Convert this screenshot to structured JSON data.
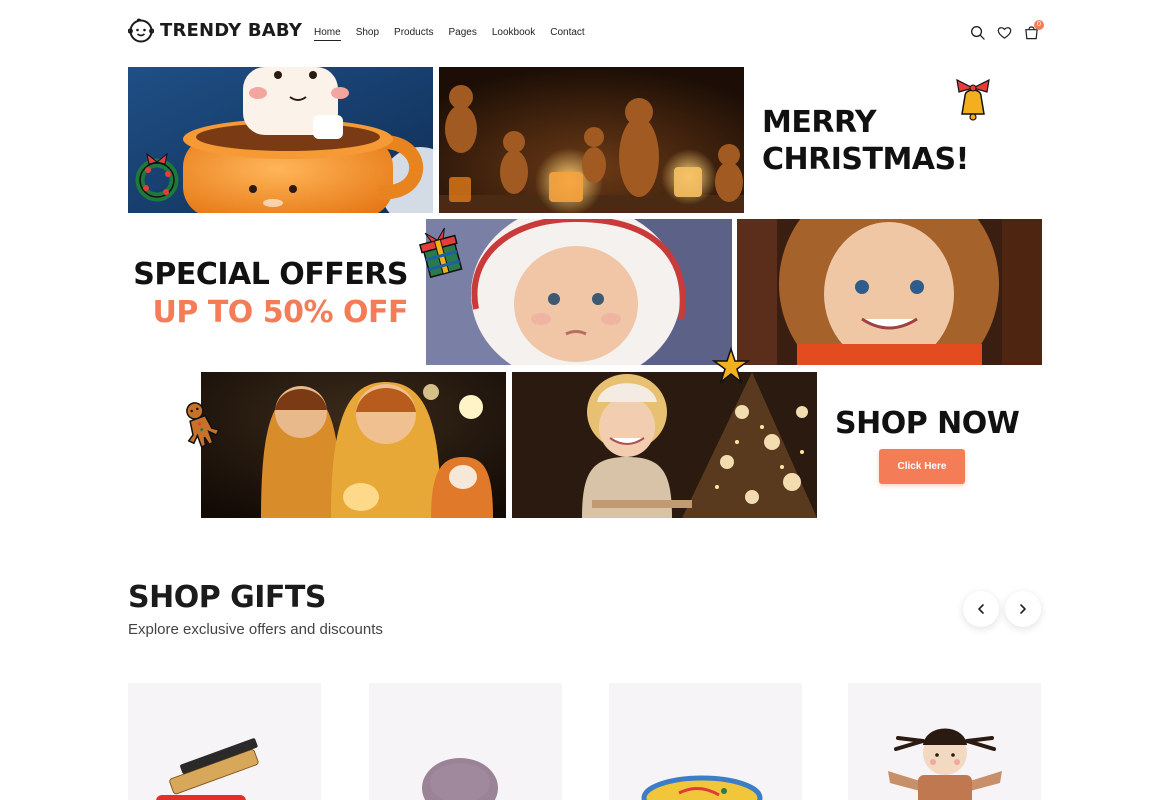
{
  "brand": {
    "name": "TRENDY BABY"
  },
  "nav": {
    "items": [
      {
        "label": "Home",
        "active": true
      },
      {
        "label": "Shop",
        "active": false
      },
      {
        "label": "Products",
        "active": false
      },
      {
        "label": "Pages",
        "active": false
      },
      {
        "label": "Lookbook",
        "active": false
      },
      {
        "label": "Contact",
        "active": false
      }
    ]
  },
  "header_icons": {
    "search": "search-icon",
    "wishlist": "heart-icon",
    "cart": "shopping-bag-icon",
    "cart_count": "0"
  },
  "hero": {
    "merry_line1": "MERRY",
    "merry_line2": "CHRISTMAS!",
    "special_line1": "SPECIAL OFFERS",
    "special_line2": "UP TO 50% OFF",
    "shop_now": "SHOP NOW",
    "cta_label": "Click Here"
  },
  "gifts": {
    "title": "SHOP GIFTS",
    "subtitle": "Explore exclusive offers and discounts",
    "prev_icon": "chevron-left-icon",
    "next_icon": "chevron-right-icon"
  },
  "colors": {
    "accent": "#f47c57",
    "text": "#1b1b1b",
    "card_bg": "#f6f4f6"
  }
}
